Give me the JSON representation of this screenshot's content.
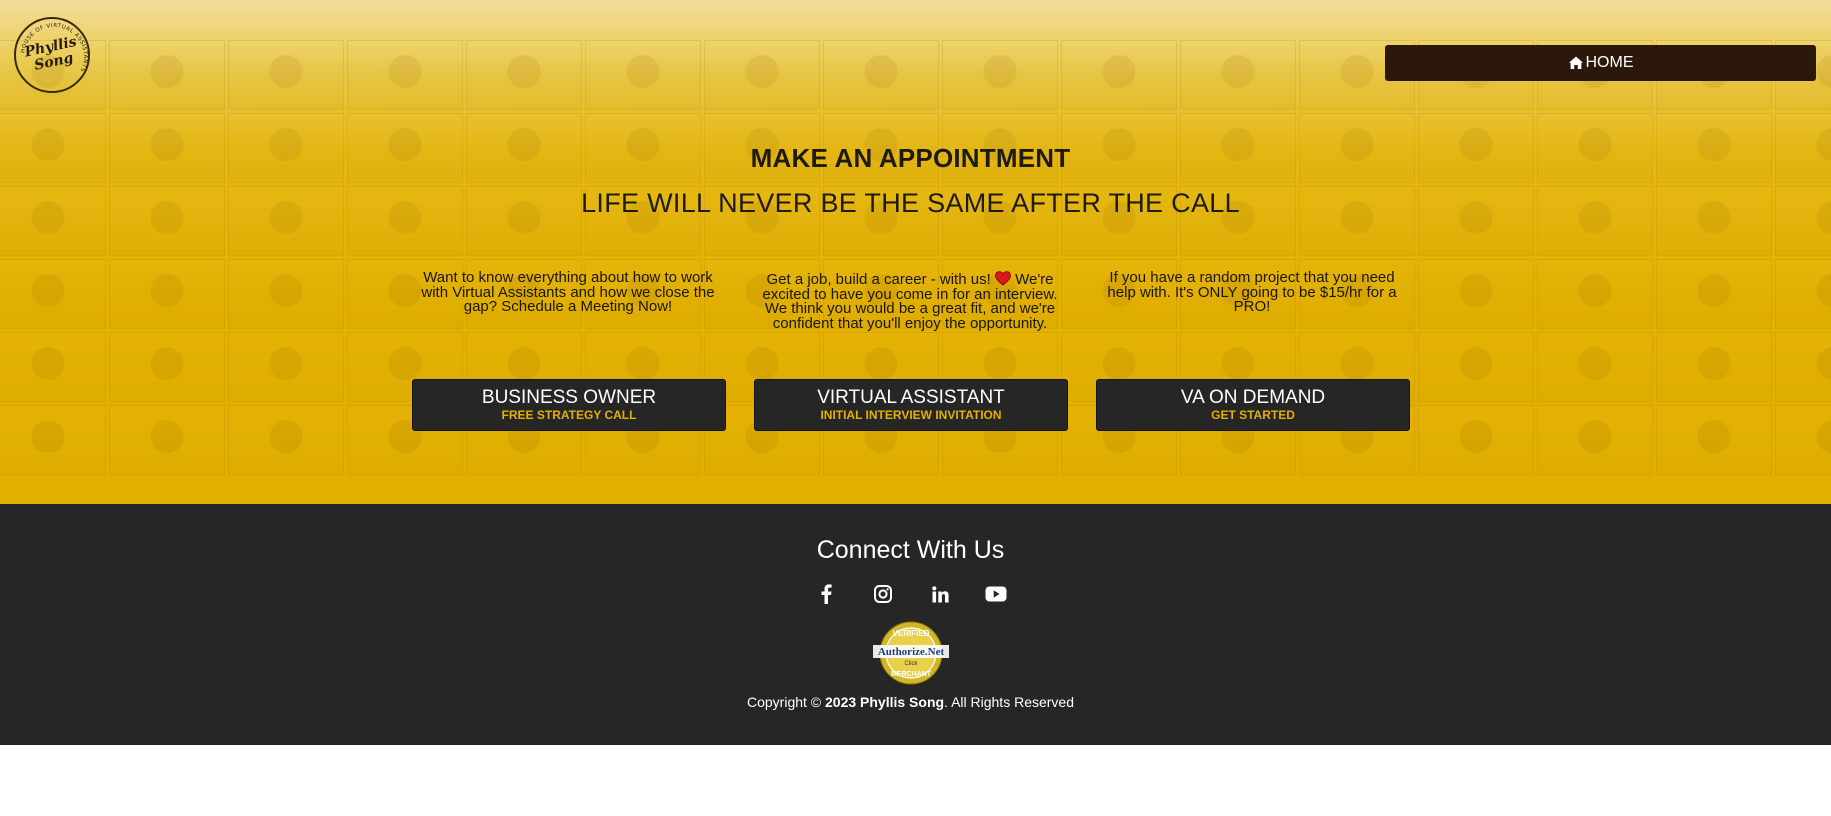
{
  "logo": {
    "text_line1": "Phyllis",
    "text_line2": "Song",
    "ring_text": "HOUSE OF VIRTUAL ASSISTANTS"
  },
  "nav": {
    "home_label": "HOME"
  },
  "hero": {
    "title": "MAKE AN APPOINTMENT",
    "subtitle": "LIFE WILL NEVER BE THE SAME AFTER THE CALL",
    "columns": [
      {
        "text": "Want to know everything about how to work with Virtual Assistants and how we close the gap? Schedule a Meeting Now!",
        "button_title": "BUSINESS OWNER",
        "button_sub": "FREE STRATEGY CALL"
      },
      {
        "text_before_heart": "Get a job, build a career - with us!",
        "text_after_heart": "We're excited to have you come in for an interview. We think you would be a great fit, and we're confident that you'll enjoy the opportunity.",
        "button_title": "VIRTUAL ASSISTANT",
        "button_sub": "INITIAL INTERVIEW INVITATION"
      },
      {
        "text": "If you have a random project that you need help with. It's ONLY going to be $15/hr for a PRO!",
        "button_title": "VA ON DEMAND",
        "button_sub": "GET STARTED"
      }
    ]
  },
  "footer": {
    "connect_title": "Connect With Us",
    "social_icons": [
      "facebook-icon",
      "instagram-icon",
      "linkedin-icon",
      "youtube-icon"
    ],
    "seal": {
      "top": "VERIFIED",
      "brand": "Authorize.Net",
      "click": "Click",
      "bottom": "MERCHANT"
    },
    "copyright_prefix": "Copyright © ",
    "copyright_strong": "2023 Phyllis Song",
    "copyright_suffix": ". All Rights Reserved"
  },
  "colors": {
    "accent": "#e4b100",
    "dark": "#262626",
    "home_button": "#2b180a",
    "heart": "#e0161e"
  }
}
